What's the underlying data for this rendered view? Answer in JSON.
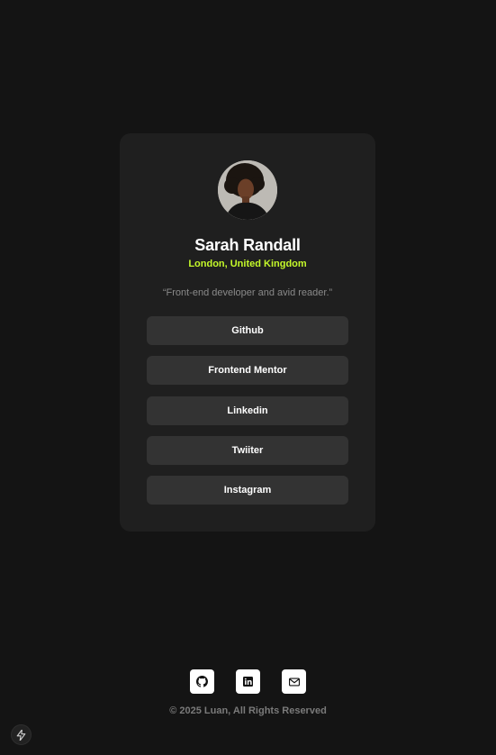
{
  "profile": {
    "name": "Sarah Randall",
    "location": "London, United Kingdom",
    "bio": "“Front-end developer and avid reader.”",
    "avatar_icon": "profile-photo"
  },
  "links": [
    {
      "label": "Github"
    },
    {
      "label": "Frontend Mentor"
    },
    {
      "label": "Linkedin"
    },
    {
      "label": "Twiiter"
    },
    {
      "label": "Instagram"
    }
  ],
  "footer": {
    "socials": [
      {
        "icon": "github-icon"
      },
      {
        "icon": "linkedin-icon"
      },
      {
        "icon": "mail-icon"
      }
    ],
    "copyright": "© 2025 Luan, All Rights Reserved"
  },
  "colors": {
    "background": "#141414",
    "card": "#1f1f1f",
    "button": "#333333",
    "accent": "#c4f82a",
    "muted": "#8a8a8a"
  },
  "corner_badge": {
    "icon": "lightning-icon"
  }
}
